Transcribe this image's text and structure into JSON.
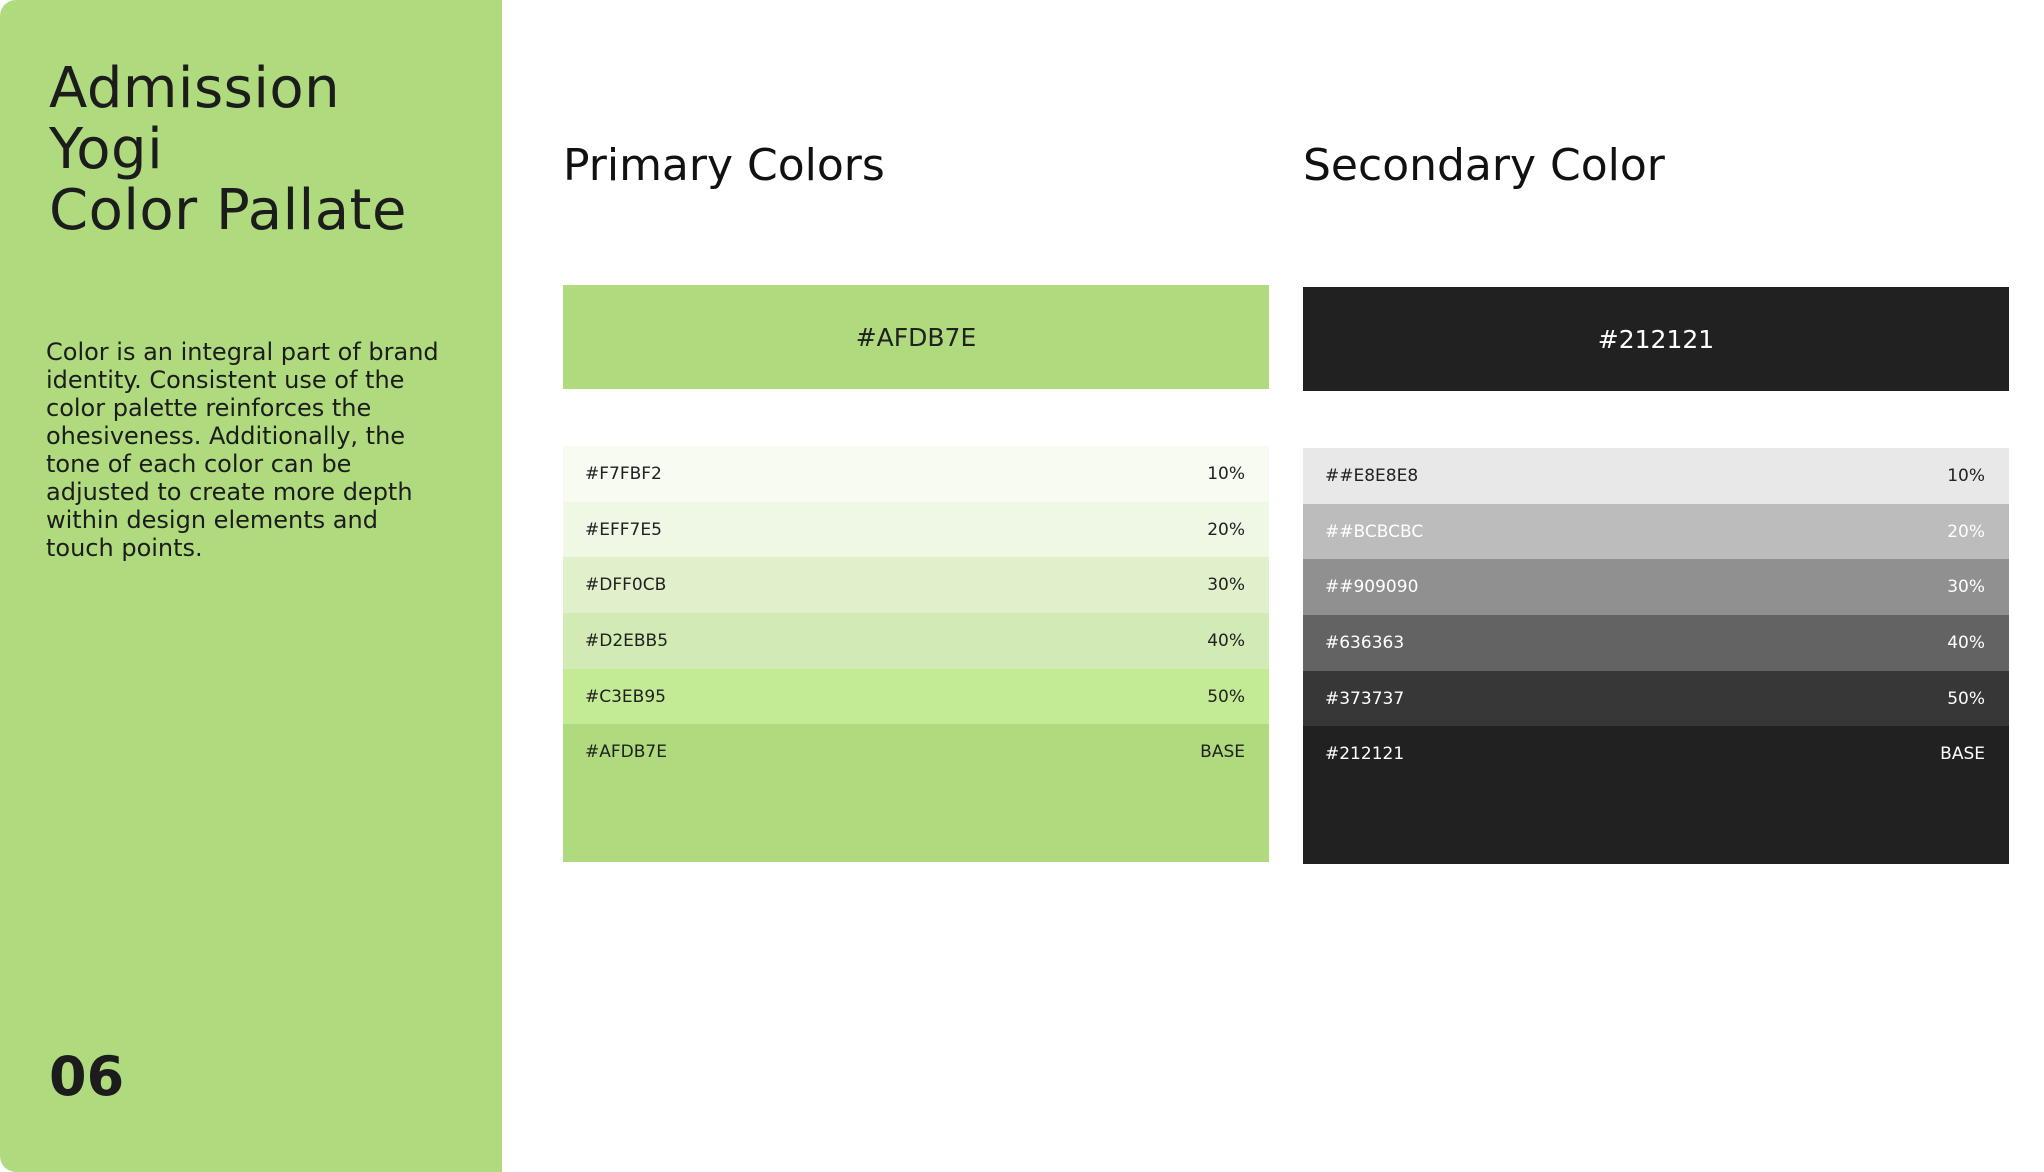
{
  "sidebar": {
    "title_lines": [
      "Admission",
      "Yogi",
      "Color Pallate"
    ],
    "description": "Color is an integral part of brand identity. Consistent use of the color palette reinforces the ohesiveness. Additionally, the tone of each color can be adjusted to create more depth within design elements and touch points.",
    "page_number": "06",
    "background_color": "#AFDB7E"
  },
  "primary": {
    "title": "Primary Colors",
    "main_swatch": {
      "label": "#AFDB7E",
      "color": "#AFDB7E"
    },
    "scale": [
      {
        "hex": "#F7FBF2",
        "tint": "10%",
        "color": "#F7FBF2"
      },
      {
        "hex": "#EFF7E5",
        "tint": "20%",
        "color": "#EFF7E5"
      },
      {
        "hex": "#DFF0CB",
        "tint": "30%",
        "color": "#DFF0CB"
      },
      {
        "hex": "#D2EBB5",
        "tint": "40%",
        "color": "#D2EBB5"
      },
      {
        "hex": "#C3EB95",
        "tint": "50%",
        "color": "#C3EB95"
      },
      {
        "hex": "#AFDB7E",
        "tint": "BASE",
        "color": "#AFDB7E"
      }
    ]
  },
  "secondary": {
    "title": "Secondary Color",
    "main_swatch": {
      "label": "#212121",
      "color": "#212121"
    },
    "scale": [
      {
        "hex": "##E8E8E8",
        "tint": "10%",
        "color": "#E8E8E8"
      },
      {
        "hex": "##BCBCBC",
        "tint": "20%",
        "color": "#BCBCBC"
      },
      {
        "hex": "##909090",
        "tint": "30%",
        "color": "#909090"
      },
      {
        "hex": "#636363",
        "tint": "40%",
        "color": "#636363"
      },
      {
        "hex": "#373737",
        "tint": "50%",
        "color": "#373737"
      },
      {
        "hex": "#212121",
        "tint": "BASE",
        "color": "#212121"
      }
    ]
  }
}
